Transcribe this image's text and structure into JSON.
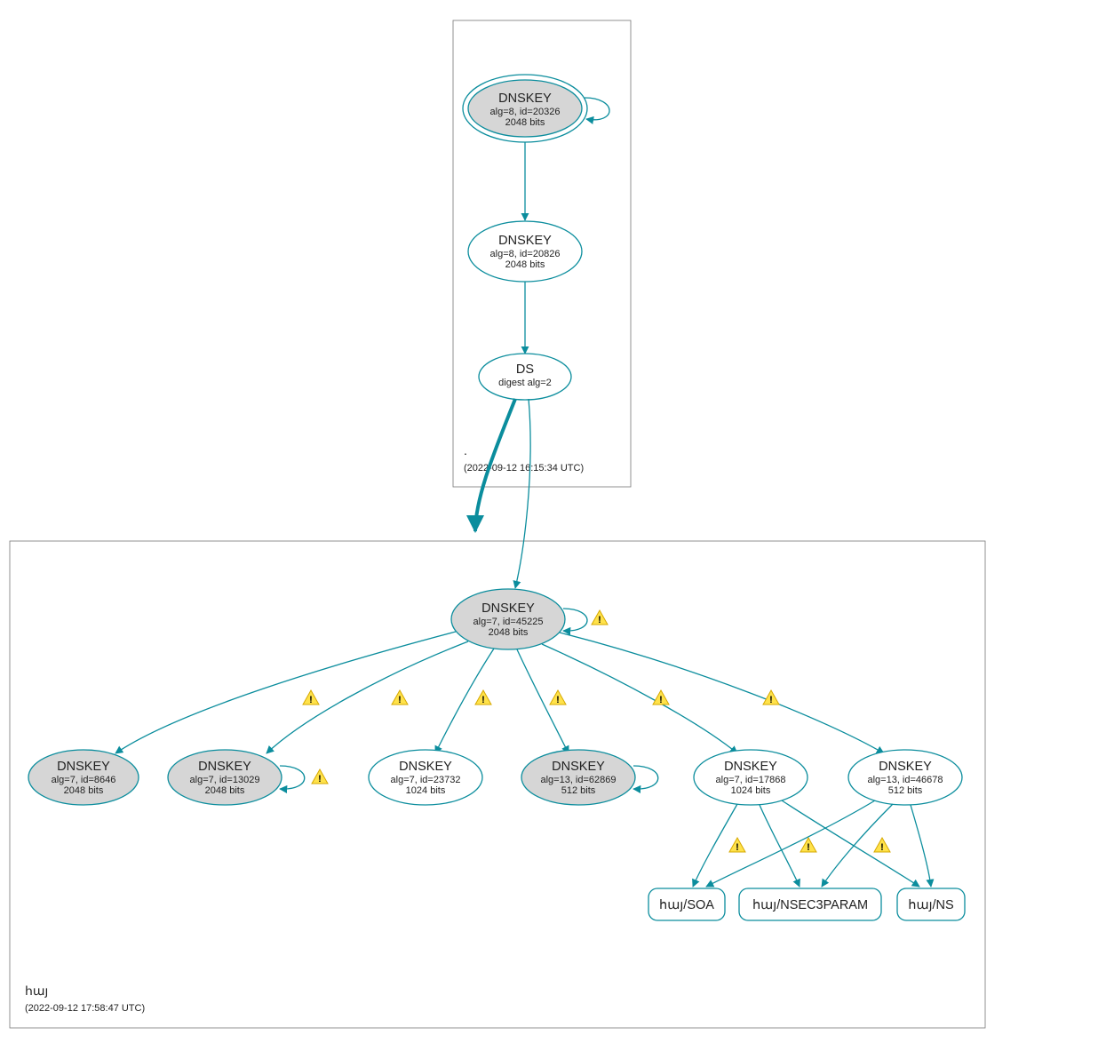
{
  "zones": {
    "root": {
      "label": ".",
      "timestamp": "(2022-09-12 16:15:34 UTC)"
    },
    "child": {
      "label": "հայ",
      "timestamp": "(2022-09-12 17:58:47 UTC)"
    }
  },
  "nodes": {
    "root_ksk": {
      "title": "DNSKEY",
      "line1": "alg=8, id=20326",
      "line2": "2048 bits"
    },
    "root_zsk": {
      "title": "DNSKEY",
      "line1": "alg=8, id=20826",
      "line2": "2048 bits"
    },
    "ds": {
      "title": "DS",
      "line1": "digest alg=2",
      "line2": ""
    },
    "child_ksk": {
      "title": "DNSKEY",
      "line1": "alg=7, id=45225",
      "line2": "2048 bits"
    },
    "k8646": {
      "title": "DNSKEY",
      "line1": "alg=7, id=8646",
      "line2": "2048 bits"
    },
    "k13029": {
      "title": "DNSKEY",
      "line1": "alg=7, id=13029",
      "line2": "2048 bits"
    },
    "k23732": {
      "title": "DNSKEY",
      "line1": "alg=7, id=23732",
      "line2": "1024 bits"
    },
    "k62869": {
      "title": "DNSKEY",
      "line1": "alg=13, id=62869",
      "line2": "512 bits"
    },
    "k17868": {
      "title": "DNSKEY",
      "line1": "alg=7, id=17868",
      "line2": "1024 bits"
    },
    "k46678": {
      "title": "DNSKEY",
      "line1": "alg=13, id=46678",
      "line2": "512 bits"
    }
  },
  "records": {
    "soa": "հայ/SOA",
    "nsec3": "հայ/NSEC3PARAM",
    "ns": "հայ/NS"
  }
}
